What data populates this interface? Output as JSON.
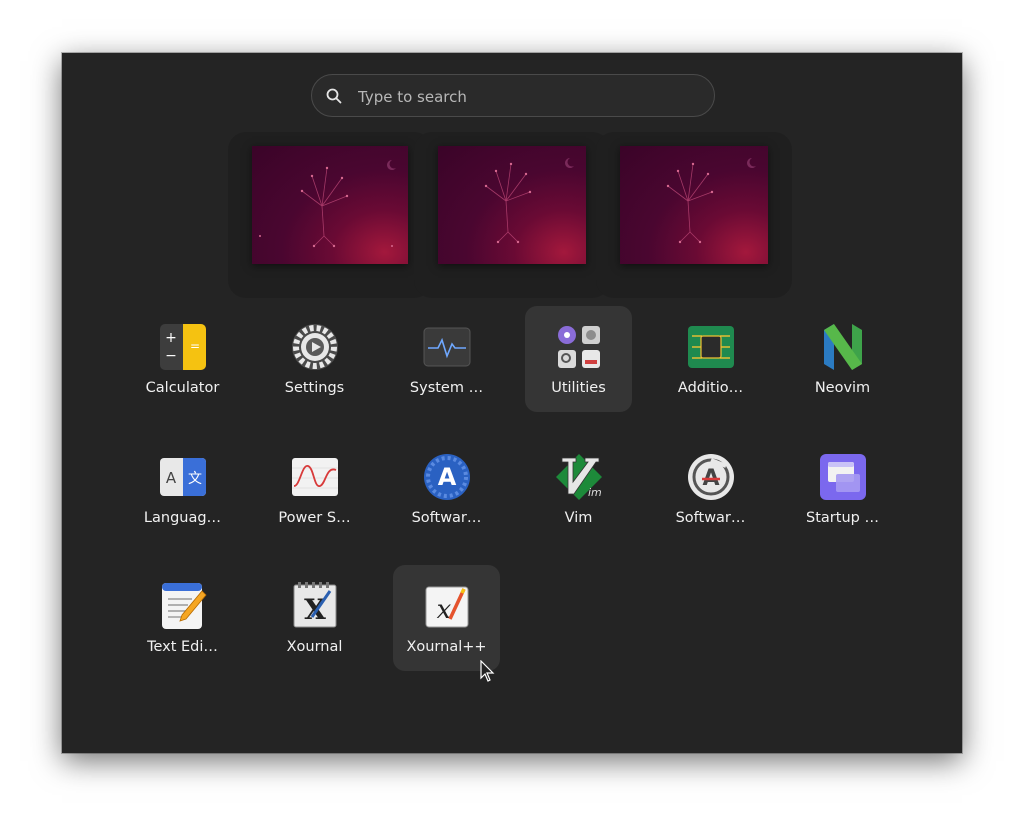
{
  "search": {
    "placeholder": "Type to search",
    "icon": "search-icon"
  },
  "workspaces": [
    {
      "name": "workspace-1"
    },
    {
      "name": "workspace-2"
    },
    {
      "name": "workspace-3"
    }
  ],
  "apps": [
    {
      "label": "Calculator",
      "icon": "calculator-icon"
    },
    {
      "label": "Settings",
      "icon": "settings-gear-icon"
    },
    {
      "label": "System …",
      "icon": "system-monitor-icon"
    },
    {
      "label": "Utilities",
      "icon": "utilities-folder-icon"
    },
    {
      "label": "Additio…",
      "icon": "chip-icon"
    },
    {
      "label": "Neovim",
      "icon": "neovim-icon"
    },
    {
      "label": "Languag…",
      "icon": "language-icon"
    },
    {
      "label": "Power S…",
      "icon": "power-statistics-icon"
    },
    {
      "label": "Softwar…",
      "icon": "software-store-icon"
    },
    {
      "label": "Vim",
      "icon": "vim-icon"
    },
    {
      "label": "Softwar…",
      "icon": "software-updater-icon"
    },
    {
      "label": "Startup …",
      "icon": "startup-apps-icon"
    },
    {
      "label": "Text Edi…",
      "icon": "text-editor-icon"
    },
    {
      "label": "Xournal",
      "icon": "xournal-icon"
    },
    {
      "label": "Xournal++",
      "icon": "xournalpp-icon"
    }
  ],
  "colors": {
    "background": "#242424",
    "tile_highlight": "#353535",
    "wallpaper": "#5a0832",
    "accent_yellow": "#f5c211"
  }
}
